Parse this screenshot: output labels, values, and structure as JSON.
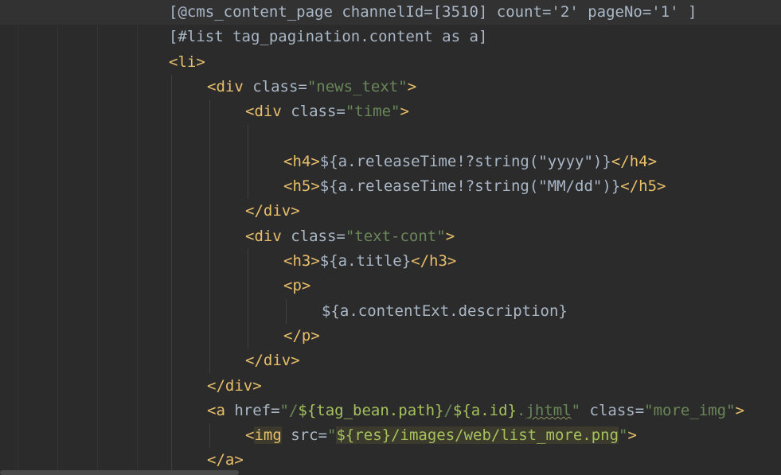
{
  "colors": {
    "background": "#2b2b2b",
    "current_line": "#323232",
    "text": "#a9b7c6",
    "tag": "#e8bf6a",
    "attr_value": "#6a8759",
    "attr_value_light": "#a5c25c",
    "highlight_bg": "#3b3a2c",
    "indent_guide": "#3f3f3f"
  },
  "editor": {
    "lines": [
      {
        "indent": 0,
        "current": true,
        "tokens": [
          {
            "t": "[@cms_content_page channelId=[3510] count='2' pageNo='1' ]",
            "c": "text"
          }
        ]
      },
      {
        "indent": 0,
        "tokens": [
          {
            "t": "[#list tag_pagination.content as a]",
            "c": "text"
          }
        ]
      },
      {
        "indent": 0,
        "tokens": [
          {
            "t": "<li>",
            "c": "tag"
          }
        ]
      },
      {
        "indent": 1,
        "tokens": [
          {
            "t": "<div ",
            "c": "tag"
          },
          {
            "t": "class=",
            "c": "text"
          },
          {
            "t": "\"news_text\"",
            "c": "value"
          },
          {
            "t": ">",
            "c": "tag"
          }
        ]
      },
      {
        "indent": 2,
        "tokens": [
          {
            "t": "<div ",
            "c": "tag"
          },
          {
            "t": "class=",
            "c": "text"
          },
          {
            "t": "\"time\"",
            "c": "value"
          },
          {
            "t": ">",
            "c": "tag"
          }
        ]
      },
      {
        "indent": 3,
        "tokens": []
      },
      {
        "indent": 3,
        "tokens": [
          {
            "t": "<h4>",
            "c": "tag"
          },
          {
            "t": "${a.releaseTime!?string(\"yyyy\")}",
            "c": "text"
          },
          {
            "t": "</h4>",
            "c": "tag"
          }
        ]
      },
      {
        "indent": 3,
        "tokens": [
          {
            "t": "<h5>",
            "c": "tag"
          },
          {
            "t": "${a.releaseTime!?string(\"MM/dd\")}",
            "c": "text"
          },
          {
            "t": "</h5>",
            "c": "tag"
          }
        ]
      },
      {
        "indent": 2,
        "tokens": [
          {
            "t": "</div>",
            "c": "tag"
          }
        ]
      },
      {
        "indent": 2,
        "tokens": [
          {
            "t": "<div ",
            "c": "tag"
          },
          {
            "t": "class=",
            "c": "text"
          },
          {
            "t": "\"text-cont\"",
            "c": "value"
          },
          {
            "t": ">",
            "c": "tag"
          }
        ]
      },
      {
        "indent": 3,
        "tokens": [
          {
            "t": "<h3>",
            "c": "tag"
          },
          {
            "t": "${a.title}",
            "c": "text"
          },
          {
            "t": "</h3>",
            "c": "tag"
          }
        ]
      },
      {
        "indent": 3,
        "tokens": [
          {
            "t": "<p>",
            "c": "tag"
          }
        ]
      },
      {
        "indent": 4,
        "tokens": [
          {
            "t": "${a.contentExt.description}",
            "c": "text"
          }
        ]
      },
      {
        "indent": 3,
        "tokens": [
          {
            "t": "</p>",
            "c": "tag"
          }
        ]
      },
      {
        "indent": 2,
        "tokens": [
          {
            "t": "</div>",
            "c": "tag"
          }
        ]
      },
      {
        "indent": 1,
        "tokens": [
          {
            "t": "</div>",
            "c": "tag"
          }
        ]
      },
      {
        "indent": 1,
        "tokens": [
          {
            "t": "<a ",
            "c": "tag"
          },
          {
            "t": "href=",
            "c": "text"
          },
          {
            "t": "\"/",
            "c": "value"
          },
          {
            "t": "${tag_bean.path}",
            "c": "value-light"
          },
          {
            "t": "/",
            "c": "value"
          },
          {
            "t": "${a.id}",
            "c": "value-light"
          },
          {
            "t": ".",
            "c": "value"
          },
          {
            "t": "jhtml",
            "c": "value-squiggle"
          },
          {
            "t": "\" ",
            "c": "value"
          },
          {
            "t": "class=",
            "c": "text"
          },
          {
            "t": "\"more_img\"",
            "c": "value"
          },
          {
            "t": ">",
            "c": "tag"
          }
        ]
      },
      {
        "indent": 2,
        "tokens": [
          {
            "t": "<",
            "c": "tag"
          },
          {
            "t": "img",
            "c": "tag-hl"
          },
          {
            "t": " src=",
            "c": "text"
          },
          {
            "t": "\"",
            "c": "value"
          },
          {
            "t": "${res}/images/web/list_more.png",
            "c": "value-light-hl"
          },
          {
            "t": "\"",
            "c": "value"
          },
          {
            "t": ">",
            "c": "tag"
          }
        ]
      },
      {
        "indent": 1,
        "tokens": [
          {
            "t": "</a>",
            "c": "tag"
          }
        ]
      }
    ]
  }
}
